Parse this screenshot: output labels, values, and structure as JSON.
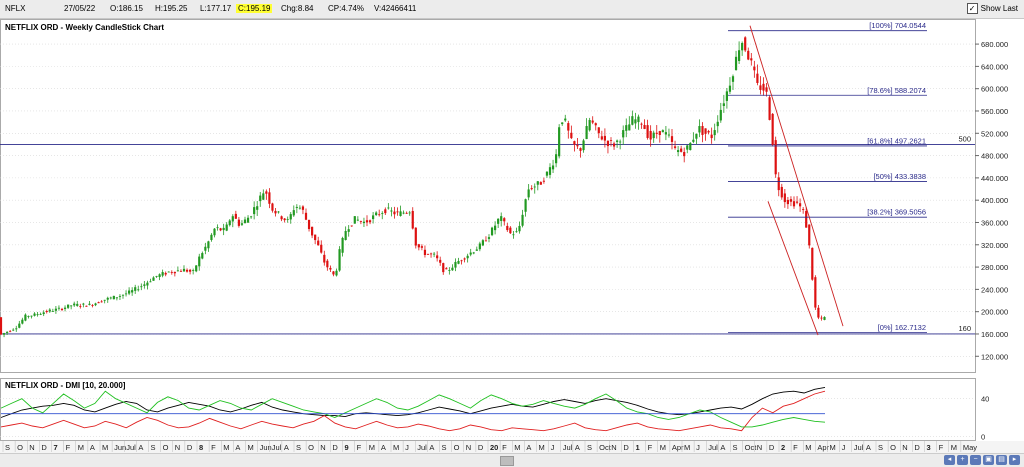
{
  "header": {
    "symbol": "NFLX",
    "date": "27/05/22",
    "open": "O:186.15",
    "high": "H:195.25",
    "low": "L:177.17",
    "close": "C:195.19",
    "change": "Chg:8.84",
    "change_pct": "CP:4.74%",
    "volume": "V:42466411",
    "show_last_label": "Show Last",
    "show_last_checked": "✓"
  },
  "chart_data": [
    {
      "type": "candlestick",
      "title": "NETFLIX ORD - Weekly CandleStick Chart",
      "y_ticks": [
        "120.000",
        "160.000",
        "200.000",
        "240.000",
        "280.000",
        "320.000",
        "360.000",
        "400.000",
        "440.000",
        "480.000",
        "520.000",
        "560.000",
        "600.000",
        "640.000",
        "680.000"
      ],
      "ylim": [
        90,
        725
      ],
      "x_tick_labels": [
        "S",
        "O",
        "N",
        "D",
        "7",
        "F",
        "M",
        "A",
        "M",
        "Jun",
        "Jul",
        "A",
        "S",
        "O",
        "N",
        "D",
        "8",
        "F",
        "M",
        "A",
        "M",
        "Jun",
        "Jul",
        "A",
        "S",
        "O",
        "N",
        "D",
        "9",
        "F",
        "M",
        "A",
        "M",
        "J",
        "Jul",
        "A",
        "S",
        "O",
        "N",
        "D",
        "20",
        "F",
        "M",
        "A",
        "M",
        "J",
        "Jul",
        "A",
        "S",
        "Oct",
        "N",
        "D",
        "1",
        "F",
        "M",
        "Apr",
        "M",
        "J",
        "Jul",
        "A",
        "S",
        "Oct",
        "N",
        "D",
        "2",
        "F",
        "M",
        "Apr",
        "M",
        "J",
        "Jul",
        "A",
        "S",
        "O",
        "N",
        "D",
        "3",
        "F",
        "M",
        "May"
      ],
      "ohlc_path": [
        [
          0,
          158
        ],
        [
          8,
          165
        ],
        [
          16,
          172
        ],
        [
          26,
          193
        ],
        [
          34,
          194
        ],
        [
          45,
          200
        ],
        [
          60,
          205
        ],
        [
          72,
          212
        ],
        [
          90,
          212
        ],
        [
          105,
          222
        ],
        [
          115,
          226
        ],
        [
          130,
          235
        ],
        [
          145,
          250
        ],
        [
          155,
          263
        ],
        [
          170,
          272
        ],
        [
          185,
          275
        ],
        [
          193,
          270
        ],
        [
          200,
          300
        ],
        [
          207,
          320
        ],
        [
          215,
          350
        ],
        [
          225,
          345
        ],
        [
          232,
          375
        ],
        [
          240,
          355
        ],
        [
          250,
          372
        ],
        [
          258,
          398
        ],
        [
          265,
          420
        ],
        [
          272,
          385
        ],
        [
          280,
          372
        ],
        [
          288,
          362
        ],
        [
          295,
          390
        ],
        [
          302,
          385
        ],
        [
          310,
          346
        ],
        [
          318,
          318
        ],
        [
          325,
          286
        ],
        [
          335,
          262
        ],
        [
          340,
          312
        ],
        [
          346,
          348
        ],
        [
          355,
          366
        ],
        [
          365,
          360
        ],
        [
          375,
          372
        ],
        [
          385,
          383
        ],
        [
          398,
          375
        ],
        [
          410,
          382
        ],
        [
          416,
          320
        ],
        [
          425,
          305
        ],
        [
          435,
          300
        ],
        [
          445,
          270
        ],
        [
          458,
          290
        ],
        [
          470,
          305
        ],
        [
          480,
          318
        ],
        [
          490,
          340
        ],
        [
          500,
          370
        ],
        [
          510,
          340
        ],
        [
          518,
          342
        ],
        [
          528,
          420
        ],
        [
          540,
          430
        ],
        [
          548,
          450
        ],
        [
          556,
          480
        ],
        [
          560,
          550
        ],
        [
          565,
          540
        ],
        [
          572,
          500
        ],
        [
          580,
          490
        ],
        [
          590,
          545
        ],
        [
          598,
          520
        ],
        [
          606,
          505
        ],
        [
          615,
          500
        ],
        [
          625,
          525
        ],
        [
          633,
          545
        ],
        [
          642,
          540
        ],
        [
          650,
          510
        ],
        [
          660,
          525
        ],
        [
          668,
          515
        ],
        [
          675,
          490
        ],
        [
          684,
          486
        ],
        [
          690,
          500
        ],
        [
          698,
          530
        ],
        [
          705,
          520
        ],
        [
          712,
          515
        ],
        [
          720,
          560
        ],
        [
          728,
          600
        ],
        [
          735,
          645
        ],
        [
          741,
          690
        ],
        [
          746,
          670
        ],
        [
          752,
          640
        ],
        [
          758,
          600
        ],
        [
          762,
          605
        ],
        [
          767,
          588
        ],
        [
          770,
          545
        ],
        [
          773,
          500
        ],
        [
          775,
          450
        ],
        [
          778,
          425
        ],
        [
          785,
          400
        ],
        [
          792,
          395
        ],
        [
          797,
          395
        ],
        [
          803,
          380
        ],
        [
          808,
          340
        ],
        [
          812,
          265
        ],
        [
          816,
          195
        ],
        [
          820,
          185
        ],
        [
          825,
          190
        ]
      ],
      "fibonacci": [
        {
          "label": "[100%] 704.0544",
          "value": 704.0544
        },
        {
          "label": "[78.6%] 588.2074",
          "value": 588.2074
        },
        {
          "label": "[61.8%] 497.2621",
          "value": 497.2621
        },
        {
          "label": "[50%] 433.3838",
          "value": 433.3838
        },
        {
          "label": "[38.2%] 369.5056",
          "value": 369.5056
        },
        {
          "label": "[0%] 162.7132",
          "value": 162.7132
        }
      ],
      "horizontal_lines": [
        {
          "label": "500",
          "value": 500
        },
        {
          "label": "160",
          "value": 160
        }
      ],
      "trend_channel": {
        "upper": {
          "from_x": 750,
          "from_y": 713,
          "to_x": 843,
          "to_y": 174
        },
        "lower": {
          "from_x": 768,
          "from_y": 398,
          "to_x": 818,
          "to_y": 158
        }
      }
    },
    {
      "type": "line",
      "title": "NETFLIX ORD - DMI [10, 20.000]",
      "y_ticks": [
        "40",
        "0"
      ],
      "ylim": [
        -5,
        62
      ],
      "series": [
        {
          "color": "#000000",
          "values": [
            20,
            24,
            28,
            30,
            32,
            33,
            35,
            33,
            28,
            26,
            30,
            34,
            37,
            35,
            28,
            26,
            30,
            33,
            36,
            34,
            32,
            28,
            26,
            29,
            33,
            36,
            31,
            28,
            26,
            24,
            23,
            22,
            22,
            21,
            24,
            25,
            24,
            23,
            22,
            23,
            25,
            28,
            31,
            29,
            27,
            24,
            27,
            30,
            32,
            34,
            32,
            31,
            34,
            37,
            39,
            37,
            35,
            38,
            40,
            38,
            36,
            33,
            29,
            26,
            24,
            23,
            24,
            26,
            28,
            30,
            31,
            29,
            34,
            40,
            45,
            47,
            48,
            46,
            50,
            52
          ]
        },
        {
          "color": "#e02020",
          "values": [
            10,
            12,
            14,
            11,
            9,
            13,
            17,
            13,
            9,
            11,
            16,
            13,
            9,
            15,
            20,
            17,
            12,
            9,
            10,
            14,
            19,
            15,
            11,
            8,
            12,
            16,
            13,
            11,
            9,
            13,
            16,
            22,
            14,
            10,
            8,
            12,
            16,
            12,
            9,
            10,
            13,
            11,
            8,
            6,
            8,
            12,
            10,
            7,
            6,
            9,
            8,
            7,
            6,
            8,
            11,
            14,
            9,
            7,
            6,
            9,
            12,
            14,
            10,
            8,
            7,
            6,
            8,
            10,
            12,
            9,
            8,
            6,
            20,
            30,
            25,
            32,
            35,
            40,
            45,
            48
          ]
        },
        {
          "color": "#20c020",
          "values": [
            30,
            35,
            40,
            30,
            25,
            35,
            45,
            38,
            30,
            35,
            48,
            40,
            35,
            30,
            25,
            36,
            42,
            38,
            30,
            28,
            33,
            38,
            35,
            30,
            28,
            34,
            40,
            36,
            32,
            28,
            26,
            24,
            20,
            25,
            30,
            35,
            40,
            36,
            30,
            28,
            32,
            38,
            44,
            40,
            35,
            30,
            38,
            44,
            40,
            35,
            32,
            34,
            38,
            35,
            32,
            30,
            34,
            40,
            45,
            38,
            30,
            26,
            24,
            20,
            18,
            20,
            24,
            28,
            26,
            20,
            15,
            10,
            10,
            12,
            15,
            18,
            20,
            18,
            16,
            15
          ]
        },
        {
          "color": "#3050d0",
          "values": [
            24,
            24,
            24,
            24,
            24,
            24,
            24,
            24,
            24,
            24,
            24,
            24,
            24,
            24,
            24,
            24,
            24,
            24,
            24,
            24,
            24,
            24,
            24,
            24,
            24,
            24,
            24,
            24,
            24,
            24,
            24,
            24,
            24,
            24,
            24,
            24,
            24,
            24,
            24,
            24,
            24,
            24,
            24,
            24,
            24,
            24,
            24,
            24,
            24,
            24,
            24,
            24,
            24,
            24,
            24,
            24,
            24,
            24,
            24,
            24,
            24,
            24,
            24,
            24,
            24,
            24,
            24,
            24,
            24,
            24,
            24,
            24,
            24,
            24,
            24,
            24,
            24,
            24,
            24,
            24
          ]
        }
      ]
    }
  ],
  "colors": {
    "up": "#229922",
    "down": "#dd1111",
    "fib": "#2a2a8a",
    "trend": "#cc2222"
  }
}
